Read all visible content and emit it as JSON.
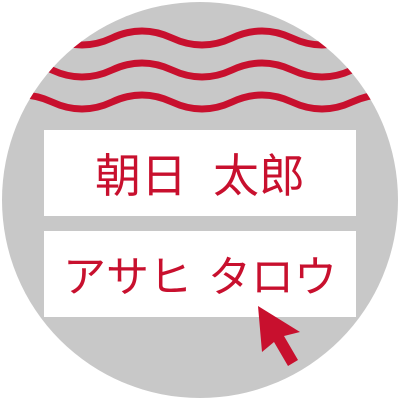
{
  "colors": {
    "accent": "#c8102e",
    "badge_background": "#c8c8c8",
    "field_background": "#ffffff"
  },
  "name_kanji": {
    "family": "朝日",
    "given": "太郎"
  },
  "name_kana": {
    "family": "アサヒ",
    "given": "タロウ"
  },
  "icons": {
    "decoration": "wavy-lines-icon",
    "pointer": "mouse-pointer-icon"
  }
}
